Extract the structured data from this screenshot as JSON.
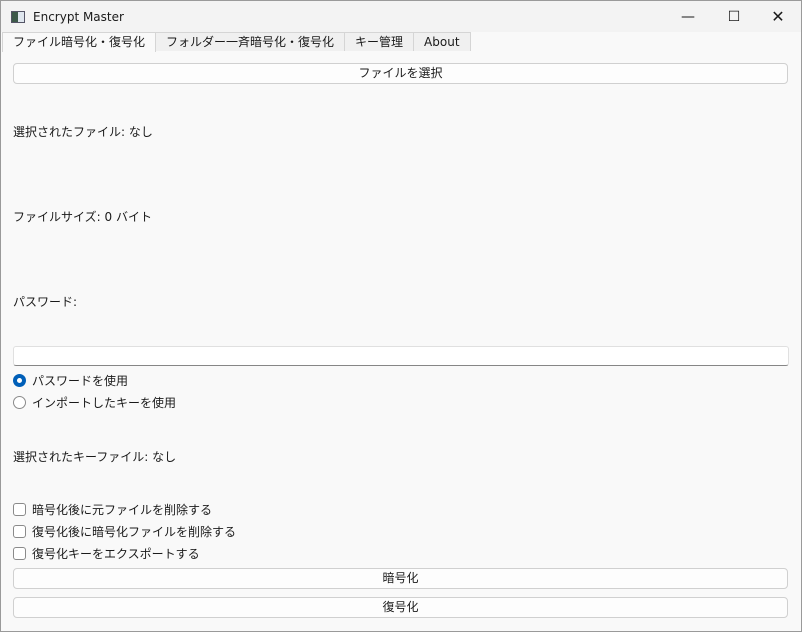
{
  "window": {
    "title": "Encrypt Master"
  },
  "tabs": [
    "ファイル暗号化・復号化",
    "フォルダー一斉暗号化・復号化",
    "キー管理",
    "About"
  ],
  "select_file_button": "ファイルを選択",
  "selected_file": "選択されたファイル: なし",
  "file_size": "ファイルサイズ: 0 バイト",
  "password_label": "パスワード:",
  "password_value": "",
  "radios": [
    {
      "label": "パスワードを使用",
      "checked": true
    },
    {
      "label": "インポートしたキーを使用",
      "checked": false
    }
  ],
  "selected_key_file": "選択されたキーファイル: なし",
  "checkboxes": [
    {
      "label": "暗号化後に元ファイルを削除する",
      "checked": false
    },
    {
      "label": "復号化後に暗号化ファイルを削除する",
      "checked": false
    },
    {
      "label": "復号化キーをエクスポートする",
      "checked": false
    }
  ],
  "encrypt_button": "暗号化",
  "decrypt_button": "復号化",
  "accent": "#005fb8"
}
